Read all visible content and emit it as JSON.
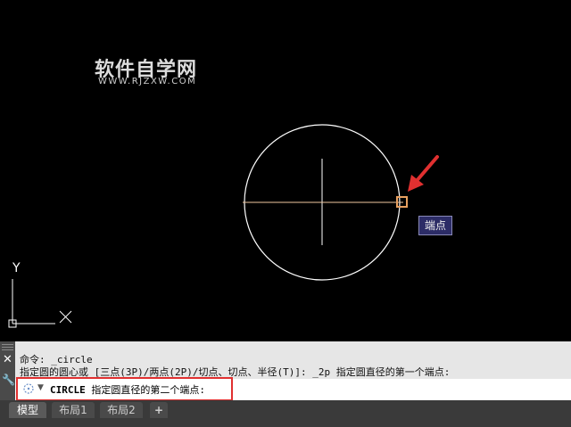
{
  "watermark": {
    "title": "软件自学网",
    "url": "WWW.RJZXW.COM"
  },
  "drawing": {
    "tooltip_label": "端点",
    "ucs_y_label": "Y",
    "ucs_x_label": "X",
    "colors": {
      "background": "#000000",
      "entity": "#ffffff",
      "rubberband": "#f0c8a0",
      "snap_marker": "#e8a060",
      "arrow": "#e03030"
    }
  },
  "command_line": {
    "history": [
      "命令: _circle",
      "指定圆的圆心或 [三点(3P)/两点(2P)/切点、切点、半径(T)]: _2p 指定圆直径的第一个端点:"
    ],
    "prompt_command": "CIRCLE",
    "prompt_text": "指定圆直径的第二个端点:",
    "input_value": ""
  },
  "layout_tabs": {
    "tabs": [
      {
        "label": "模型",
        "active": true
      },
      {
        "label": "布局1",
        "active": false
      },
      {
        "label": "布局2",
        "active": false
      }
    ],
    "add_label": "+"
  }
}
